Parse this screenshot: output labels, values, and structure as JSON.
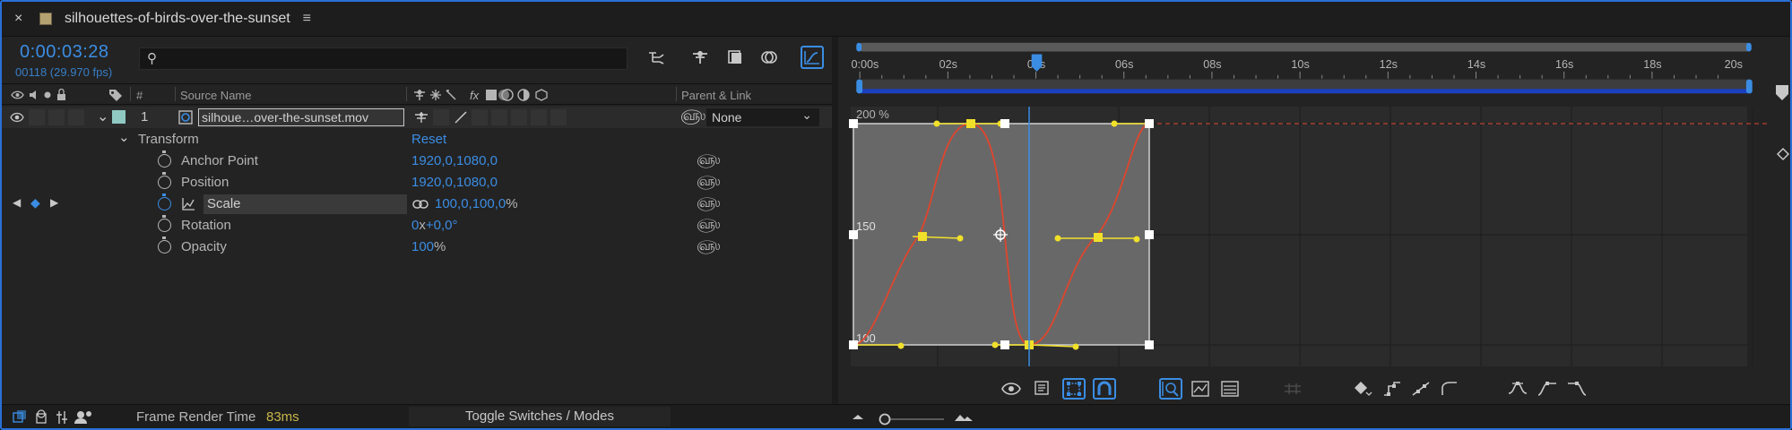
{
  "titlebar": {
    "close": "×",
    "comp_name": "silhouettes-of-birds-over-the-sunset",
    "menu": "≡"
  },
  "timeline": {
    "timecode": "0:00:03:28",
    "frames_fps": "00118 (29.970 fps)",
    "search_icon": "⚲"
  },
  "columns": {
    "number": "#",
    "source_name": "Source Name",
    "parent_link": "Parent & Link",
    "fx": "fx"
  },
  "layer": {
    "number": "1",
    "name": "silhoue…over-the-sunset.mov",
    "parent": "None"
  },
  "properties": {
    "transform_label": "Transform",
    "reset_label": "Reset",
    "anchor_point": {
      "label": "Anchor Point",
      "value": "1920,0,1080,0"
    },
    "position": {
      "label": "Position",
      "value": "1920,0,1080,0"
    },
    "scale": {
      "label": "Scale",
      "value_num": "100,0,100,0",
      "unit": "%"
    },
    "rotation": {
      "label": "Rotation",
      "turns": "0",
      "x": "x",
      "deg": "+0,0°"
    },
    "opacity": {
      "label": "Opacity",
      "value_num": "100",
      "unit": "%"
    }
  },
  "status": {
    "frame_render_label": "Frame Render Time",
    "frame_render_value": "83ms",
    "toggle_label": "Toggle Switches / Modes"
  },
  "graph": {
    "ruler_labels": [
      "0:00s",
      "02s",
      "04s",
      "06s",
      "08s",
      "10s",
      "12s",
      "14s",
      "16s",
      "18s",
      "20s"
    ],
    "y_labels": [
      "200 %",
      "150",
      "100"
    ],
    "accent": "#3b8de3",
    "curve_color": "#e0452d",
    "handle_color": "#f1e02a"
  }
}
